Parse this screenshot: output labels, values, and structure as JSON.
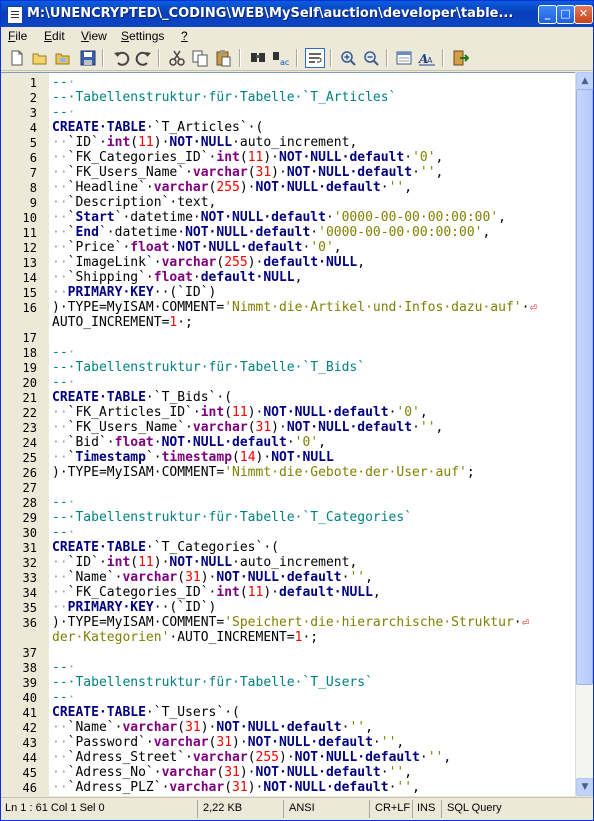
{
  "window": {
    "title": "M:\\UNENCRYPTED\\_CODING\\WEB\\MySelf\\auction\\developer\\table..."
  },
  "title_buttons": {
    "minimize": "_",
    "maximize": "□",
    "close": "✕"
  },
  "menu": {
    "items": [
      {
        "label": "File",
        "u": "F"
      },
      {
        "label": "Edit",
        "u": "E"
      },
      {
        "label": "View",
        "u": "V"
      },
      {
        "label": "Settings",
        "u": "S"
      },
      {
        "label": "?",
        "u": "?"
      }
    ]
  },
  "toolbar": {
    "icons": [
      "new-file-icon",
      "open-file-icon",
      "open-folder-icon",
      "save-icon",
      "undo-icon",
      "redo-icon",
      "cut-icon",
      "copy-icon",
      "paste-icon",
      "find-icon",
      "replace-icon",
      "word-wrap-icon",
      "zoom-in-icon",
      "zoom-out-icon",
      "view-icon",
      "font-icon",
      "exit-icon"
    ]
  },
  "editor": {
    "lines": [
      {
        "n": "1",
        "segs": [
          [
            "cm",
            "--"
          ],
          [
            "ws",
            "·"
          ]
        ]
      },
      {
        "n": "2",
        "segs": [
          [
            "cm",
            "--·Tabellenstruktur·für·Tabelle·`T_Articles`"
          ]
        ]
      },
      {
        "n": "3",
        "segs": [
          [
            "cm",
            "--"
          ],
          [
            "ws",
            "·"
          ]
        ]
      },
      {
        "n": "4",
        "segs": [
          [
            "kw",
            "CREATE·TABLE"
          ],
          [
            "",
            "·`T_Articles`·("
          ]
        ]
      },
      {
        "n": "5",
        "segs": [
          [
            "ws",
            "··"
          ],
          [
            "",
            "`ID`·"
          ],
          [
            "ty",
            "int"
          ],
          [
            "",
            "("
          ],
          [
            "nu",
            "11"
          ],
          [
            "",
            ")·"
          ],
          [
            "kw",
            "NOT·NULL"
          ],
          [
            "",
            "·auto_increment,"
          ]
        ]
      },
      {
        "n": "6",
        "segs": [
          [
            "ws",
            "··"
          ],
          [
            "",
            "`FK_Categories_ID`·"
          ],
          [
            "ty",
            "int"
          ],
          [
            "",
            "("
          ],
          [
            "nu",
            "11"
          ],
          [
            "",
            ")·"
          ],
          [
            "kw",
            "NOT·NULL·default"
          ],
          [
            "",
            "·"
          ],
          [
            "st",
            "'0'"
          ],
          [
            "",
            ","
          ]
        ]
      },
      {
        "n": "7",
        "segs": [
          [
            "ws",
            "··"
          ],
          [
            "",
            "`FK_Users_Name`·"
          ],
          [
            "ty",
            "varchar"
          ],
          [
            "",
            "("
          ],
          [
            "nu",
            "31"
          ],
          [
            "",
            ")·"
          ],
          [
            "kw",
            "NOT·NULL·default"
          ],
          [
            "",
            "·"
          ],
          [
            "st",
            "''"
          ],
          [
            "",
            ","
          ]
        ]
      },
      {
        "n": "8",
        "segs": [
          [
            "ws",
            "··"
          ],
          [
            "",
            "`Headline`·"
          ],
          [
            "ty",
            "varchar"
          ],
          [
            "",
            "("
          ],
          [
            "nu",
            "255"
          ],
          [
            "",
            ")·"
          ],
          [
            "kw",
            "NOT·NULL·default"
          ],
          [
            "",
            "·"
          ],
          [
            "st",
            "''"
          ],
          [
            "",
            ","
          ]
        ]
      },
      {
        "n": "9",
        "segs": [
          [
            "ws",
            "··"
          ],
          [
            "",
            "`Description`·text,"
          ]
        ]
      },
      {
        "n": "10",
        "segs": [
          [
            "ws",
            "··"
          ],
          [
            "",
            "`"
          ],
          [
            "kw",
            "Start"
          ],
          [
            "",
            "`·datetime·"
          ],
          [
            "kw",
            "NOT·NULL·default"
          ],
          [
            "",
            "·"
          ],
          [
            "st",
            "'0000-00-00·00:00:00'"
          ],
          [
            "",
            ","
          ]
        ]
      },
      {
        "n": "11",
        "segs": [
          [
            "ws",
            "··"
          ],
          [
            "",
            "`"
          ],
          [
            "kw",
            "End"
          ],
          [
            "",
            "`·datetime·"
          ],
          [
            "kw",
            "NOT·NULL·default"
          ],
          [
            "",
            "·"
          ],
          [
            "st",
            "'0000-00-00·00:00:00'"
          ],
          [
            "",
            ","
          ]
        ]
      },
      {
        "n": "12",
        "segs": [
          [
            "ws",
            "··"
          ],
          [
            "",
            "`Price`·"
          ],
          [
            "ty",
            "float"
          ],
          [
            "",
            "·"
          ],
          [
            "kw",
            "NOT·NULL·default"
          ],
          [
            "",
            "·"
          ],
          [
            "st",
            "'0'"
          ],
          [
            "",
            ","
          ]
        ]
      },
      {
        "n": "13",
        "segs": [
          [
            "ws",
            "··"
          ],
          [
            "",
            "`ImageLink`·"
          ],
          [
            "ty",
            "varchar"
          ],
          [
            "",
            "("
          ],
          [
            "nu",
            "255"
          ],
          [
            "",
            ")·"
          ],
          [
            "kw",
            "default·NULL"
          ],
          [
            "",
            ","
          ]
        ]
      },
      {
        "n": "14",
        "segs": [
          [
            "ws",
            "··"
          ],
          [
            "",
            "`Shipping`·"
          ],
          [
            "ty",
            "float"
          ],
          [
            "",
            "·"
          ],
          [
            "kw",
            "default·NULL"
          ],
          [
            "",
            ","
          ]
        ]
      },
      {
        "n": "15",
        "segs": [
          [
            "ws",
            "··"
          ],
          [
            "kw",
            "PRIMARY·KEY"
          ],
          [
            "",
            "··(`ID`)"
          ]
        ]
      },
      {
        "n": "16",
        "segs": [
          [
            "",
            ")·TYPE=MyISAM·COMMENT="
          ],
          [
            "st",
            "'Nimmt·die·Artikel·und·Infos·dazu·auf'"
          ],
          [
            "",
            "·"
          ],
          [
            "wr",
            "⏎"
          ]
        ]
      },
      {
        "n": "",
        "segs": [
          [
            "",
            "AUTO_INCREMENT="
          ],
          [
            "nu",
            "1"
          ],
          [
            "",
            "·;"
          ]
        ]
      },
      {
        "n": "17",
        "segs": []
      },
      {
        "n": "18",
        "segs": [
          [
            "cm",
            "--"
          ],
          [
            "ws",
            "·"
          ]
        ]
      },
      {
        "n": "19",
        "segs": [
          [
            "cm",
            "--·Tabellenstruktur·für·Tabelle·`T_Bids`"
          ]
        ]
      },
      {
        "n": "20",
        "segs": [
          [
            "cm",
            "--"
          ],
          [
            "ws",
            "·"
          ]
        ]
      },
      {
        "n": "21",
        "segs": [
          [
            "kw",
            "CREATE·TABLE"
          ],
          [
            "",
            "·`T_Bids`·("
          ]
        ]
      },
      {
        "n": "22",
        "segs": [
          [
            "ws",
            "··"
          ],
          [
            "",
            "`FK_Articles_ID`·"
          ],
          [
            "ty",
            "int"
          ],
          [
            "",
            "("
          ],
          [
            "nu",
            "11"
          ],
          [
            "",
            ")·"
          ],
          [
            "kw",
            "NOT·NULL·default"
          ],
          [
            "",
            "·"
          ],
          [
            "st",
            "'0'"
          ],
          [
            "",
            ","
          ]
        ]
      },
      {
        "n": "23",
        "segs": [
          [
            "ws",
            "··"
          ],
          [
            "",
            "`FK_Users_Name`·"
          ],
          [
            "ty",
            "varchar"
          ],
          [
            "",
            "("
          ],
          [
            "nu",
            "31"
          ],
          [
            "",
            ")·"
          ],
          [
            "kw",
            "NOT·NULL·default"
          ],
          [
            "",
            "·"
          ],
          [
            "st",
            "''"
          ],
          [
            "",
            ","
          ]
        ]
      },
      {
        "n": "24",
        "segs": [
          [
            "ws",
            "··"
          ],
          [
            "",
            "`Bid`·"
          ],
          [
            "ty",
            "float"
          ],
          [
            "",
            "·"
          ],
          [
            "kw",
            "NOT·NULL·default"
          ],
          [
            "",
            "·"
          ],
          [
            "st",
            "'0'"
          ],
          [
            "",
            ","
          ]
        ]
      },
      {
        "n": "25",
        "segs": [
          [
            "ws",
            "··"
          ],
          [
            "",
            "`"
          ],
          [
            "kw",
            "Timestamp"
          ],
          [
            "",
            "`·"
          ],
          [
            "ty",
            "timestamp"
          ],
          [
            "",
            "("
          ],
          [
            "nu",
            "14"
          ],
          [
            "",
            ")·"
          ],
          [
            "kw",
            "NOT·NULL"
          ]
        ]
      },
      {
        "n": "26",
        "segs": [
          [
            "",
            ")·TYPE=MyISAM·COMMENT="
          ],
          [
            "st",
            "'Nimmt·die·Gebote·der·User·auf'"
          ],
          [
            "",
            ";"
          ]
        ]
      },
      {
        "n": "27",
        "segs": []
      },
      {
        "n": "28",
        "segs": [
          [
            "cm",
            "--"
          ],
          [
            "ws",
            "·"
          ]
        ]
      },
      {
        "n": "29",
        "segs": [
          [
            "cm",
            "--·Tabellenstruktur·für·Tabelle·`T_Categories`"
          ]
        ]
      },
      {
        "n": "30",
        "segs": [
          [
            "cm",
            "--"
          ],
          [
            "ws",
            "·"
          ]
        ]
      },
      {
        "n": "31",
        "segs": [
          [
            "kw",
            "CREATE·TABLE"
          ],
          [
            "",
            "·`T_Categories`·("
          ]
        ]
      },
      {
        "n": "32",
        "segs": [
          [
            "ws",
            "··"
          ],
          [
            "",
            "`ID`·"
          ],
          [
            "ty",
            "int"
          ],
          [
            "",
            "("
          ],
          [
            "nu",
            "11"
          ],
          [
            "",
            ")·"
          ],
          [
            "kw",
            "NOT·NULL"
          ],
          [
            "",
            "·auto_increment,"
          ]
        ]
      },
      {
        "n": "33",
        "segs": [
          [
            "ws",
            "··"
          ],
          [
            "",
            "`Name`·"
          ],
          [
            "ty",
            "varchar"
          ],
          [
            "",
            "("
          ],
          [
            "nu",
            "31"
          ],
          [
            "",
            ")·"
          ],
          [
            "kw",
            "NOT·NULL·default"
          ],
          [
            "",
            "·"
          ],
          [
            "st",
            "''"
          ],
          [
            "",
            ","
          ]
        ]
      },
      {
        "n": "34",
        "segs": [
          [
            "ws",
            "··"
          ],
          [
            "",
            "`FK_Categories_ID`·"
          ],
          [
            "ty",
            "int"
          ],
          [
            "",
            "("
          ],
          [
            "nu",
            "11"
          ],
          [
            "",
            ")·"
          ],
          [
            "kw",
            "default·NULL"
          ],
          [
            "",
            ","
          ]
        ]
      },
      {
        "n": "35",
        "segs": [
          [
            "ws",
            "··"
          ],
          [
            "kw",
            "PRIMARY·KEY"
          ],
          [
            "",
            "··(`ID`)"
          ]
        ]
      },
      {
        "n": "36",
        "segs": [
          [
            "",
            ")·TYPE=MyISAM·COMMENT="
          ],
          [
            "st",
            "'Speichert·die·hierarchische·Struktur"
          ],
          [
            "",
            "·"
          ],
          [
            "wr",
            "⏎"
          ]
        ]
      },
      {
        "n": "",
        "segs": [
          [
            "st",
            "der·Kategorien'"
          ],
          [
            "",
            "·AUTO_INCREMENT="
          ],
          [
            "nu",
            "1"
          ],
          [
            "",
            "·;"
          ]
        ]
      },
      {
        "n": "37",
        "segs": []
      },
      {
        "n": "38",
        "segs": [
          [
            "cm",
            "--"
          ],
          [
            "ws",
            "·"
          ]
        ]
      },
      {
        "n": "39",
        "segs": [
          [
            "cm",
            "--·Tabellenstruktur·für·Tabelle·`T_Users`"
          ]
        ]
      },
      {
        "n": "40",
        "segs": [
          [
            "cm",
            "--"
          ],
          [
            "ws",
            "·"
          ]
        ]
      },
      {
        "n": "41",
        "segs": [
          [
            "kw",
            "CREATE·TABLE"
          ],
          [
            "",
            "·`T_Users`·("
          ]
        ]
      },
      {
        "n": "42",
        "segs": [
          [
            "ws",
            "··"
          ],
          [
            "",
            "`Name`·"
          ],
          [
            "ty",
            "varchar"
          ],
          [
            "",
            "("
          ],
          [
            "nu",
            "31"
          ],
          [
            "",
            ")·"
          ],
          [
            "kw",
            "NOT·NULL·default"
          ],
          [
            "",
            "·"
          ],
          [
            "st",
            "''"
          ],
          [
            "",
            ","
          ]
        ]
      },
      {
        "n": "43",
        "segs": [
          [
            "ws",
            "··"
          ],
          [
            "",
            "`Password`·"
          ],
          [
            "ty",
            "varchar"
          ],
          [
            "",
            "("
          ],
          [
            "nu",
            "31"
          ],
          [
            "",
            ")·"
          ],
          [
            "kw",
            "NOT·NULL·default"
          ],
          [
            "",
            "·"
          ],
          [
            "st",
            "''"
          ],
          [
            "",
            ","
          ]
        ]
      },
      {
        "n": "44",
        "segs": [
          [
            "ws",
            "··"
          ],
          [
            "",
            "`Adress_Street`·"
          ],
          [
            "ty",
            "varchar"
          ],
          [
            "",
            "("
          ],
          [
            "nu",
            "255"
          ],
          [
            "",
            ")·"
          ],
          [
            "kw",
            "NOT·NULL·default"
          ],
          [
            "",
            "·"
          ],
          [
            "st",
            "''"
          ],
          [
            "",
            ","
          ]
        ]
      },
      {
        "n": "45",
        "segs": [
          [
            "ws",
            "··"
          ],
          [
            "",
            "`Adress_No`·"
          ],
          [
            "ty",
            "varchar"
          ],
          [
            "",
            "("
          ],
          [
            "nu",
            "31"
          ],
          [
            "",
            ")·"
          ],
          [
            "kw",
            "NOT·NULL·default"
          ],
          [
            "",
            "·"
          ],
          [
            "st",
            "''"
          ],
          [
            "",
            ","
          ]
        ]
      },
      {
        "n": "46",
        "segs": [
          [
            "ws",
            "··"
          ],
          [
            "",
            "`Adress_PLZ`·"
          ],
          [
            "ty",
            "varchar"
          ],
          [
            "",
            "("
          ],
          [
            "nu",
            "31"
          ],
          [
            "",
            ")·"
          ],
          [
            "kw",
            "NOT·NULL·default"
          ],
          [
            "",
            "·"
          ],
          [
            "st",
            "''"
          ],
          [
            "",
            ","
          ]
        ]
      }
    ]
  },
  "status": {
    "position": "Ln 1 : 61   Col 1   Sel 0",
    "size": "2,22 KB",
    "encoding": "ANSI",
    "line_endings": "CR+LF",
    "mode": "INS",
    "lexer": "SQL Query"
  },
  "scroll": {
    "position": 0.0
  },
  "colors": {
    "keyword": "#000080",
    "type": "#800080",
    "comment": "#008080",
    "string": "#808000",
    "number": "#ff0000",
    "titlebar": "#0a4fd0"
  }
}
